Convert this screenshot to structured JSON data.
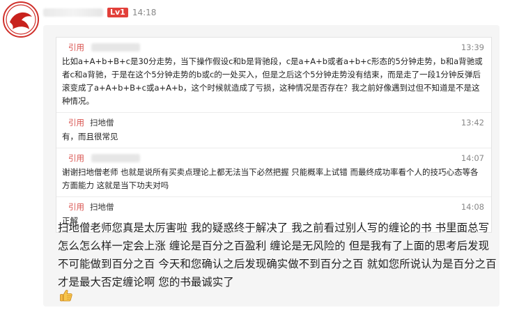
{
  "header": {
    "level": "Lv1",
    "time": "14:18"
  },
  "quotes": [
    {
      "label": "引用",
      "name": "",
      "time": "13:39",
      "text": "比如a+A+b+B+c是30分走势，当下操作假设c和b是背驰段，c是a+A+b或者a+b+c形态的5分钟走势，b和a背驰或者c和a背驰，于是在这个5分钟走势的b或c的一处买入，但是之后这个5分钟走势没有结束，而是走了一段1分钟反弹后滚变成了a+A+b+B+c或a+A+b，这个时候就造成了亏损，这种情况是否存在？我之前好像遇到过但不知道是不是这种情况。"
    },
    {
      "label": "引用",
      "name": "扫地僧",
      "time": "13:42",
      "text": "有，而且很常见"
    },
    {
      "label": "引用",
      "name": "",
      "time": "14:07",
      "text": "谢谢扫地僧老师 也就是说所有买卖点理论上都无法当下必然把握 只能概率上试错 而最终成功率看个人的技巧心态等各方面能力 这就是当下功夫对吗"
    },
    {
      "label": "引用",
      "name": "扫地僧",
      "time": "14:08",
      "text": "正解"
    }
  ],
  "reply": {
    "text": "扫地僧老师您真是太厉害啦 我的疑惑终于解决了 我之前看过别人写的缠论的书 书里面总写怎么怎么样一定会上涨 缠论是百分之百盈利 缠论是无风险的 但是我有了上面的思考后发现不可能做到百分之百 今天和您确认之后发现确实做不到百分之百 就如您所说认为是百分之百才是最大否定缠论啊 您的书最诚实了"
  },
  "icons": {
    "avatar": "red-fish-logo-icon",
    "reaction": "thumbs-up-icon"
  },
  "colors": {
    "accent": "#e2403a",
    "quote_label": "#d9534f",
    "card_bg": "#f5f5f5"
  }
}
